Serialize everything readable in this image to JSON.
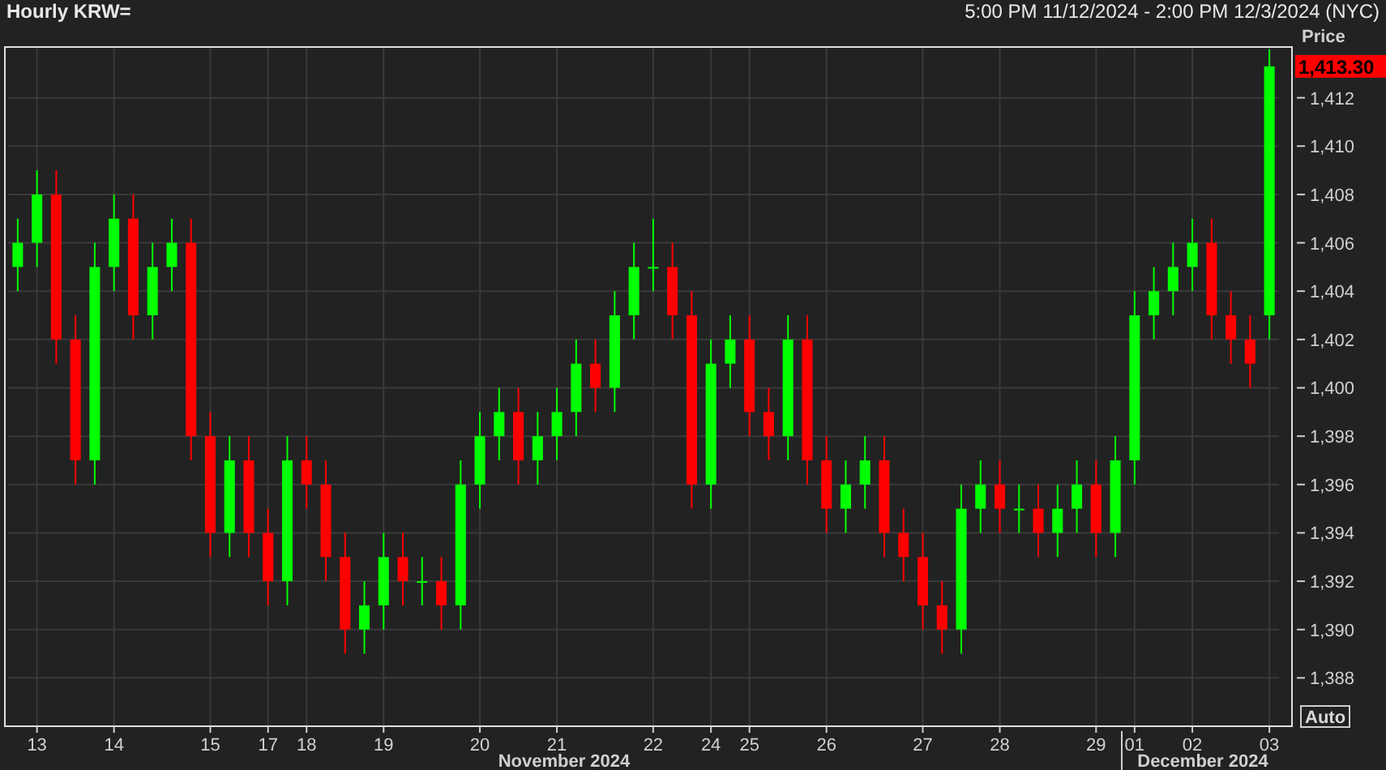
{
  "header": {
    "title": "Hourly KRW=",
    "range": "5:00 PM 11/12/2024 - 2:00 PM 12/3/2024 (NYC)"
  },
  "chart": {
    "price_heading": "Price",
    "last_price": "1,413.30",
    "auto_button": "Auto",
    "months": [
      "November 2024",
      "December 2024"
    ],
    "chart_data": {
      "type": "candlestick",
      "ylim": [
        1386,
        1414.1
      ],
      "categories": [
        null,
        "13",
        null,
        null,
        null,
        "14",
        null,
        null,
        null,
        null,
        "15",
        null,
        null,
        "17",
        null,
        "18",
        null,
        null,
        null,
        "19",
        null,
        null,
        null,
        null,
        "20",
        null,
        null,
        null,
        "21",
        null,
        null,
        null,
        null,
        "22",
        null,
        null,
        "24",
        null,
        "25",
        null,
        null,
        null,
        "26",
        null,
        null,
        null,
        null,
        "27",
        null,
        null,
        null,
        "28",
        null,
        null,
        null,
        null,
        "29",
        null,
        "01",
        null,
        null,
        "02",
        null,
        null,
        null,
        "03"
      ],
      "ohlc": [
        [
          1405,
          1407,
          1404,
          1406
        ],
        [
          1406,
          1409,
          1405,
          1408
        ],
        [
          1408,
          1409,
          1401,
          1402
        ],
        [
          1402,
          1403,
          1396,
          1397
        ],
        [
          1397,
          1406,
          1396,
          1405
        ],
        [
          1405,
          1408,
          1404,
          1407
        ],
        [
          1407,
          1408,
          1402,
          1403
        ],
        [
          1403,
          1406,
          1402,
          1405
        ],
        [
          1405,
          1407,
          1404,
          1406
        ],
        [
          1406,
          1407,
          1397,
          1398
        ],
        [
          1398,
          1399,
          1393,
          1394
        ],
        [
          1394,
          1398,
          1393,
          1397
        ],
        [
          1397,
          1398,
          1393,
          1394
        ],
        [
          1394,
          1395,
          1391,
          1392
        ],
        [
          1392,
          1398,
          1391,
          1397
        ],
        [
          1397,
          1398,
          1395,
          1396
        ],
        [
          1396,
          1397,
          1392,
          1393
        ],
        [
          1393,
          1394,
          1389,
          1390
        ],
        [
          1390,
          1392,
          1389,
          1391
        ],
        [
          1391,
          1394,
          1390,
          1393
        ],
        [
          1393,
          1394,
          1391,
          1392
        ],
        [
          1392,
          1393,
          1391,
          1392
        ],
        [
          1392,
          1393,
          1390,
          1391
        ],
        [
          1391,
          1397,
          1390,
          1396
        ],
        [
          1396,
          1399,
          1395,
          1398
        ],
        [
          1398,
          1400,
          1397,
          1399
        ],
        [
          1399,
          1400,
          1396,
          1397
        ],
        [
          1397,
          1399,
          1396,
          1398
        ],
        [
          1398,
          1400,
          1397,
          1399
        ],
        [
          1399,
          1402,
          1398,
          1401
        ],
        [
          1401,
          1402,
          1399,
          1400
        ],
        [
          1400,
          1404,
          1399,
          1403
        ],
        [
          1403,
          1406,
          1402,
          1405
        ],
        [
          1405,
          1407,
          1404,
          1405
        ],
        [
          1405,
          1406,
          1402,
          1403
        ],
        [
          1403,
          1404,
          1395,
          1396
        ],
        [
          1396,
          1402,
          1395,
          1401
        ],
        [
          1401,
          1403,
          1400,
          1402
        ],
        [
          1402,
          1403,
          1398,
          1399
        ],
        [
          1399,
          1400,
          1397,
          1398
        ],
        [
          1398,
          1403,
          1397,
          1402
        ],
        [
          1402,
          1403,
          1396,
          1397
        ],
        [
          1397,
          1398,
          1394,
          1395
        ],
        [
          1395,
          1397,
          1394,
          1396
        ],
        [
          1396,
          1398,
          1395,
          1397
        ],
        [
          1397,
          1398,
          1393,
          1394
        ],
        [
          1394,
          1395,
          1392,
          1393
        ],
        [
          1393,
          1394,
          1390,
          1391
        ],
        [
          1391,
          1392,
          1389,
          1390
        ],
        [
          1390,
          1396,
          1389,
          1395
        ],
        [
          1395,
          1397,
          1394,
          1396
        ],
        [
          1396,
          1397,
          1394,
          1395
        ],
        [
          1395,
          1396,
          1394,
          1395
        ],
        [
          1395,
          1396,
          1393,
          1394
        ],
        [
          1394,
          1396,
          1393,
          1395
        ],
        [
          1395,
          1397,
          1394,
          1396
        ],
        [
          1396,
          1397,
          1393,
          1394
        ],
        [
          1394,
          1398,
          1393,
          1397
        ],
        [
          1397,
          1404,
          1396,
          1403
        ],
        [
          1403,
          1405,
          1402,
          1404
        ],
        [
          1404,
          1406,
          1403,
          1405
        ],
        [
          1405,
          1407,
          1404,
          1406
        ],
        [
          1406,
          1407,
          1402,
          1403
        ],
        [
          1403,
          1404,
          1401,
          1402
        ],
        [
          1402,
          1403,
          1400,
          1401
        ],
        [
          1403,
          1414,
          1402,
          1413.3
        ]
      ],
      "grid": true,
      "yticks": [
        {
          "value": 1388,
          "label": "1,388"
        },
        {
          "value": 1390,
          "label": "1,390"
        },
        {
          "value": 1392,
          "label": "1,392"
        },
        {
          "value": 1394,
          "label": "1,394"
        },
        {
          "value": 1396,
          "label": "1,396"
        },
        {
          "value": 1398,
          "label": "1,398"
        },
        {
          "value": 1400,
          "label": "1,400"
        },
        {
          "value": 1402,
          "label": "1,402"
        },
        {
          "value": 1404,
          "label": "1,404"
        },
        {
          "value": 1406,
          "label": "1,406"
        },
        {
          "value": 1408,
          "label": "1,408"
        },
        {
          "value": 1410,
          "label": "1,410"
        },
        {
          "value": 1412,
          "label": "1,412"
        }
      ]
    }
  }
}
